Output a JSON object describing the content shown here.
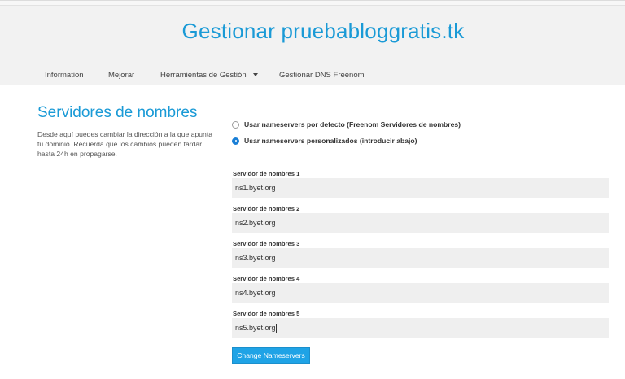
{
  "header": {
    "domain_title": "Gestionar pruebabloggratis.tk"
  },
  "nav": {
    "items": [
      {
        "label": "Information"
      },
      {
        "label": "Mejorar"
      },
      {
        "label": "Herramientas de Gestión",
        "has_dropdown": true
      },
      {
        "label": "Gestionar DNS Freenom"
      }
    ]
  },
  "sidebar": {
    "title": "Servidores de nombres",
    "description": "Desde aquí puedes cambiar la dirección a la que apunta tu dominio. Recuerda que los cambios pueden tardar hasta 24h en propagarse."
  },
  "options": {
    "default_label": "Usar nameservers por defecto (Freenom Servidores de nombres)",
    "default_checked": false,
    "custom_label": "Usar nameservers personalizados (introducir abajo)",
    "custom_checked": true
  },
  "nameservers": [
    {
      "label": "Servidor de nombres 1",
      "value": "ns1.byet.org"
    },
    {
      "label": "Servidor de nombres 2",
      "value": "ns2.byet.org"
    },
    {
      "label": "Servidor de nombres 3",
      "value": "ns3.byet.org"
    },
    {
      "label": "Servidor de nombres 4",
      "value": "ns4.byet.org"
    },
    {
      "label": "Servidor de nombres 5",
      "value": "ns5.byet.org"
    }
  ],
  "actions": {
    "change_label": "Change Nameservers"
  },
  "colors": {
    "accent": "#1a9ad6",
    "button": "#1fa3e6",
    "input_bg": "#efefef",
    "header_bg": "#f2f2f2"
  }
}
